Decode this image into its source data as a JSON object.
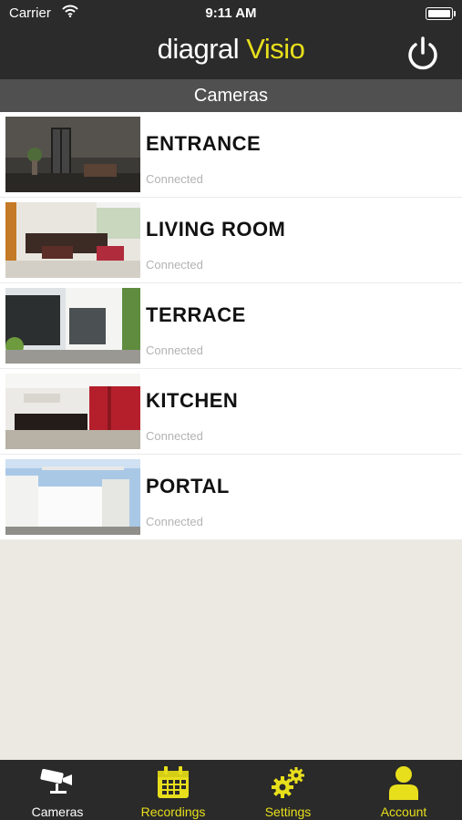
{
  "status_bar": {
    "carrier": "Carrier",
    "time": "9:11 AM",
    "icons": [
      "wifi-icon",
      "battery-icon"
    ]
  },
  "header": {
    "brand_first": "diagral",
    "brand_second": "Visio",
    "power_icon": "power-icon"
  },
  "section": {
    "title": "Cameras"
  },
  "cameras": [
    {
      "name": "ENTRANCE",
      "status": "Connected"
    },
    {
      "name": "LIVING ROOM",
      "status": "Connected"
    },
    {
      "name": "TERRACE",
      "status": "Connected"
    },
    {
      "name": "KITCHEN",
      "status": "Connected"
    },
    {
      "name": "PORTAL",
      "status": "Connected"
    }
  ],
  "tabs": [
    {
      "label": "Cameras",
      "icon": "camera-icon",
      "active": true
    },
    {
      "label": "Recordings",
      "icon": "calendar-icon",
      "active": false
    },
    {
      "label": "Settings",
      "icon": "gears-icon",
      "active": false
    },
    {
      "label": "Account",
      "icon": "user-icon",
      "active": false
    }
  ],
  "colors": {
    "accent": "#e8df1c",
    "header_bg": "#2b2b2b",
    "section_bg": "#505050",
    "page_bg": "#ebe9e2",
    "status_text": "#b3b3b3"
  }
}
